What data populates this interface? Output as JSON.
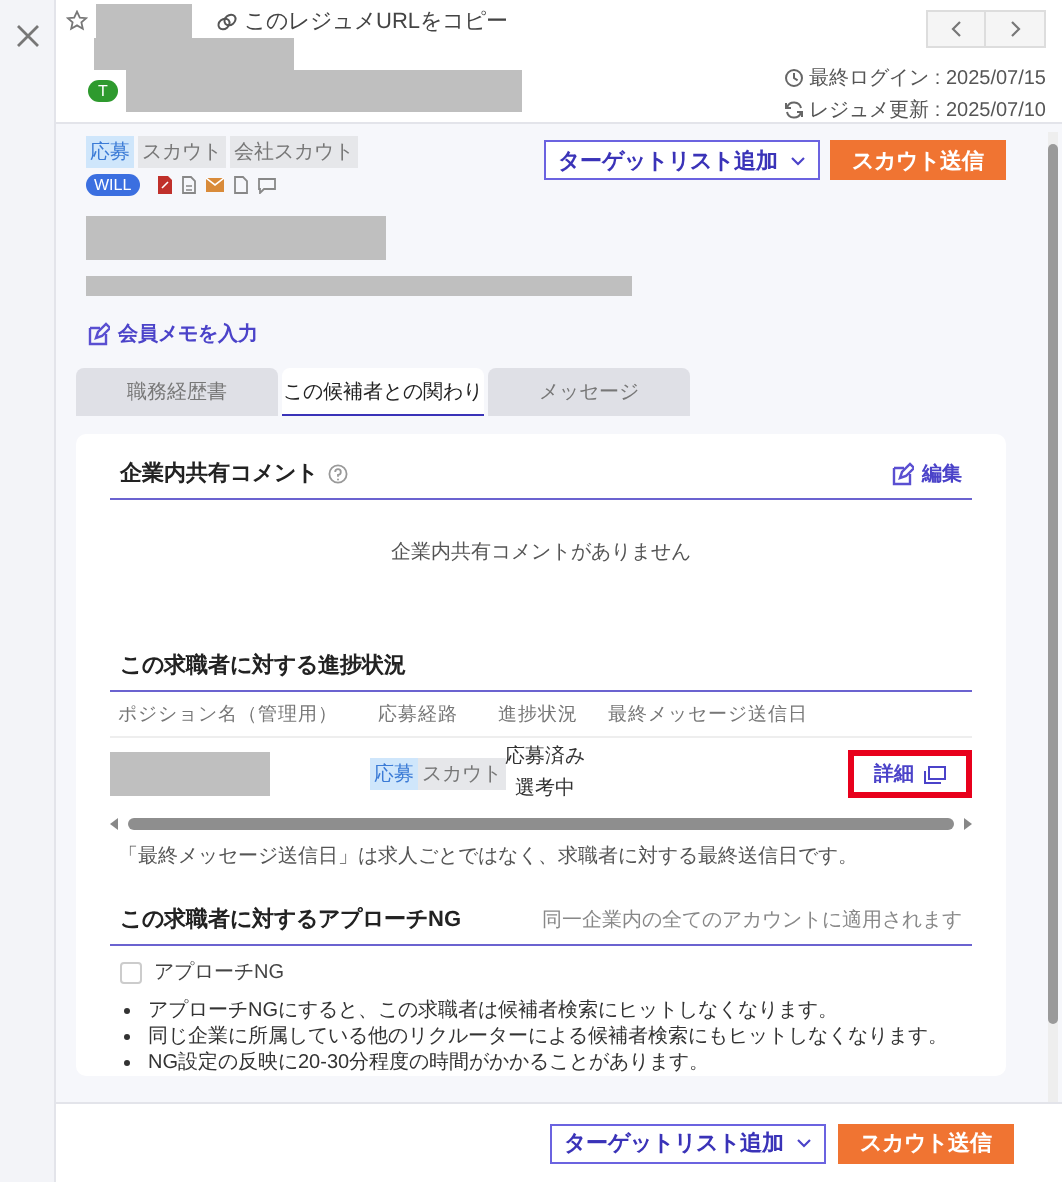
{
  "header": {
    "copy_link": "このレジュメURLをコピー",
    "badge": "T",
    "last_login": "最終ログイン : 2025/07/15",
    "resume_updated": "レジュメ更新 : 2025/07/10"
  },
  "tags": [
    {
      "label": "応募",
      "active": true
    },
    {
      "label": "スカウト",
      "active": false
    },
    {
      "label": "会社スカウト",
      "active": false
    }
  ],
  "will_badge": "WILL",
  "actions": {
    "target_list": "ターゲットリスト追加",
    "scout": "スカウト送信"
  },
  "memo_link": "会員メモを入力",
  "tabs": [
    {
      "label": "職務経歴書",
      "selected": false
    },
    {
      "label": "この候補者との関わり",
      "selected": true
    },
    {
      "label": "メッセージ",
      "selected": false
    }
  ],
  "comment_section": {
    "title": "企業内共有コメント",
    "edit": "編集",
    "empty": "企業内共有コメントがありません"
  },
  "progress": {
    "title": "この求職者に対する進捗状況",
    "columns": [
      "ポジション名（管理用）",
      "応募経路",
      "進捗状況",
      "最終メッセージ送信日"
    ],
    "rows": [
      {
        "routes": [
          {
            "label": "応募",
            "active": true
          },
          {
            "label": "スカウト",
            "active": false
          }
        ],
        "status": [
          "応募済み",
          "選考中"
        ],
        "detail": "詳細",
        "highlighted": true
      }
    ],
    "note": "「最終メッセージ送信日」は求人ごとではなく、求職者に対する最終送信日です。"
  },
  "approach_ng": {
    "title": "この求職者に対するアプローチNG",
    "scope": "同一企業内の全てのアカウントに適用されます",
    "checkbox": {
      "label": "アプローチNG",
      "checked": false
    },
    "bullets": [
      "アプローチNGにすると、この求職者は候補者検索にヒットしなくなります。",
      "同じ企業に所属している他のリクルーターによる候補者検索にもヒットしなくなります。",
      "NG設定の反映に20-30分程度の時間がかかることがあります。"
    ]
  },
  "footer": {
    "target_list": "ターゲットリスト追加",
    "scout": "スカウト送信"
  }
}
